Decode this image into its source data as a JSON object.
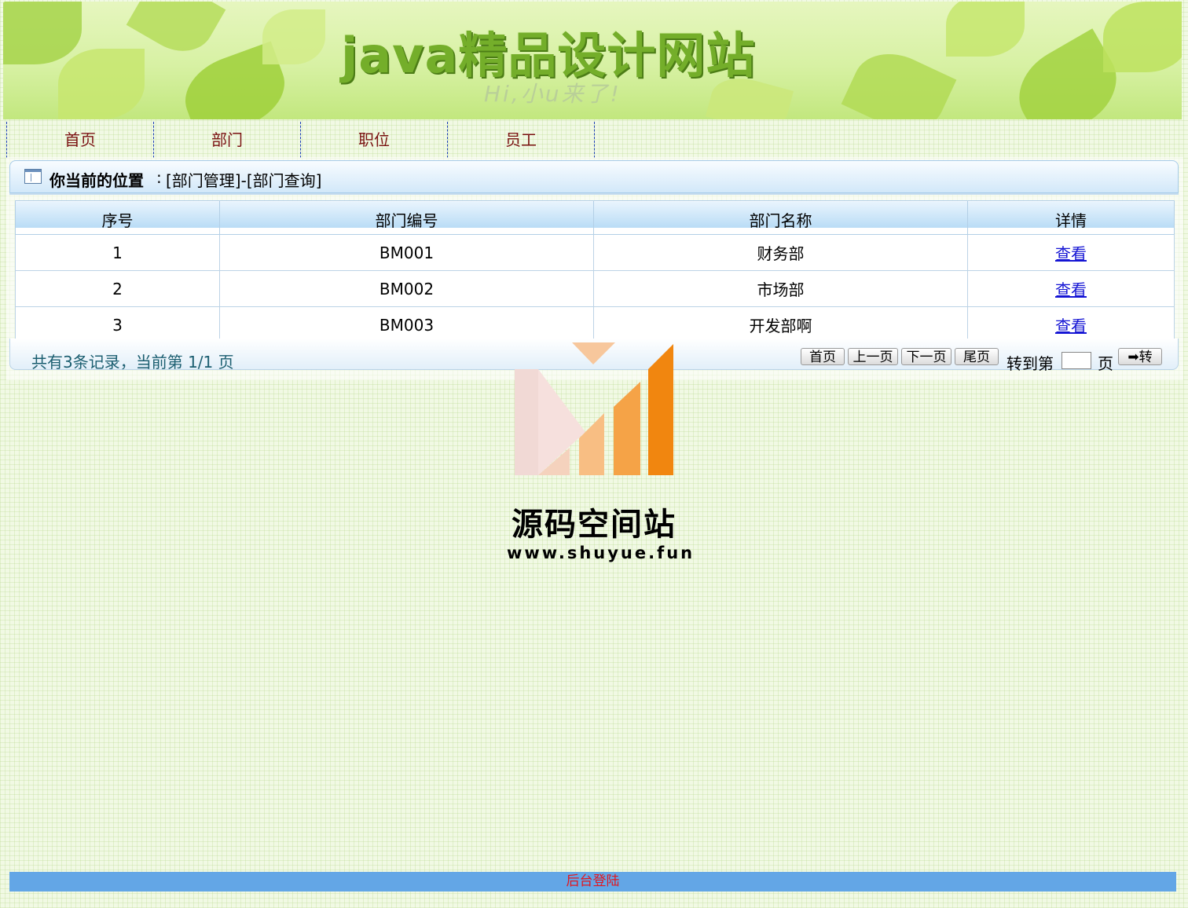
{
  "banner": {
    "title": "java精品设计网站",
    "subtitle": "Hi,小u来了!"
  },
  "nav": {
    "items": [
      "首页",
      "部门",
      "职位",
      "员工"
    ]
  },
  "breadcrumb": {
    "label": "你当前的位置",
    "separator": ":",
    "path": "[部门管理]-[部门查询]"
  },
  "table": {
    "headers": [
      "序号",
      "部门编号",
      "部门名称",
      "详情"
    ],
    "rows": [
      {
        "index": "1",
        "code": "BM001",
        "name": "财务部",
        "action": "查看"
      },
      {
        "index": "2",
        "code": "BM002",
        "name": "市场部",
        "action": "查看"
      },
      {
        "index": "3",
        "code": "BM003",
        "name": "开发部啊",
        "action": "查看"
      }
    ]
  },
  "pager": {
    "info": "共有3条记录，当前第 1/1 页",
    "first": "首页",
    "prev": "上一页",
    "next": "下一页",
    "last": "尾页",
    "goto_label": "转到第",
    "page_unit": "页",
    "go": "➡转"
  },
  "watermark": {
    "title": "源码空间站",
    "url": "www.shuyue.fun"
  },
  "footer": {
    "link": "后台登陆"
  },
  "colors": {
    "nav_text": "#7a1212",
    "link": "#1515d4",
    "footer_bg": "#63a6e6",
    "footer_text": "#e2161e"
  }
}
